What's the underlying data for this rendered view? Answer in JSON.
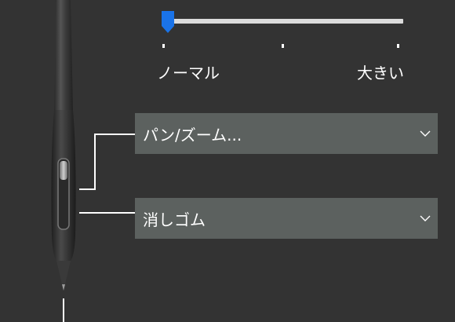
{
  "slider": {
    "label_min": "ノーマル",
    "label_max": "大きい",
    "value": 0,
    "tick_count": 3,
    "track_color": "#dcdcdc",
    "thumb_color": "#1a73e8"
  },
  "buttons": [
    {
      "label": "パン/ズーム...",
      "icon": "chevron-down-icon"
    },
    {
      "label": "消しゴム",
      "icon": "chevron-down-icon"
    }
  ],
  "colors": {
    "background": "#333333",
    "dropdown": "#5c615f",
    "text": "#ffffff"
  }
}
